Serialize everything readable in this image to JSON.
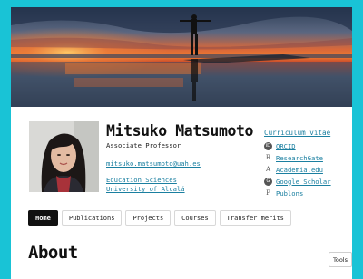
{
  "profile": {
    "name": "Mitsuko Matsumoto",
    "title": "Associate Professor",
    "email": "mitsuko.matsumoto@uah.es",
    "affiliations": [
      "Education Sciences",
      "University of Alcalá"
    ]
  },
  "sidebar": {
    "cv_label": "Curriculum vitae",
    "links": [
      {
        "label": "ORCID",
        "icon": "orcid-icon",
        "glyph": "iD"
      },
      {
        "label": "ResearchGate",
        "icon": "researchgate-icon",
        "glyph": "R"
      },
      {
        "label": "Academia.edu",
        "icon": "academia-icon",
        "glyph": "A"
      },
      {
        "label": "Google Scholar",
        "icon": "google-scholar-icon",
        "glyph": "G"
      },
      {
        "label": "Publons",
        "icon": "publons-icon",
        "glyph": "P"
      }
    ]
  },
  "nav": {
    "tabs": [
      "Home",
      "Publications",
      "Projects",
      "Courses",
      "Transfer merits"
    ],
    "active": "Home"
  },
  "main": {
    "heading": "About"
  },
  "tools_label": "Tools",
  "colors": {
    "background": "#19c3d6",
    "link": "#1a7fa0",
    "active_tab": "#111111"
  }
}
